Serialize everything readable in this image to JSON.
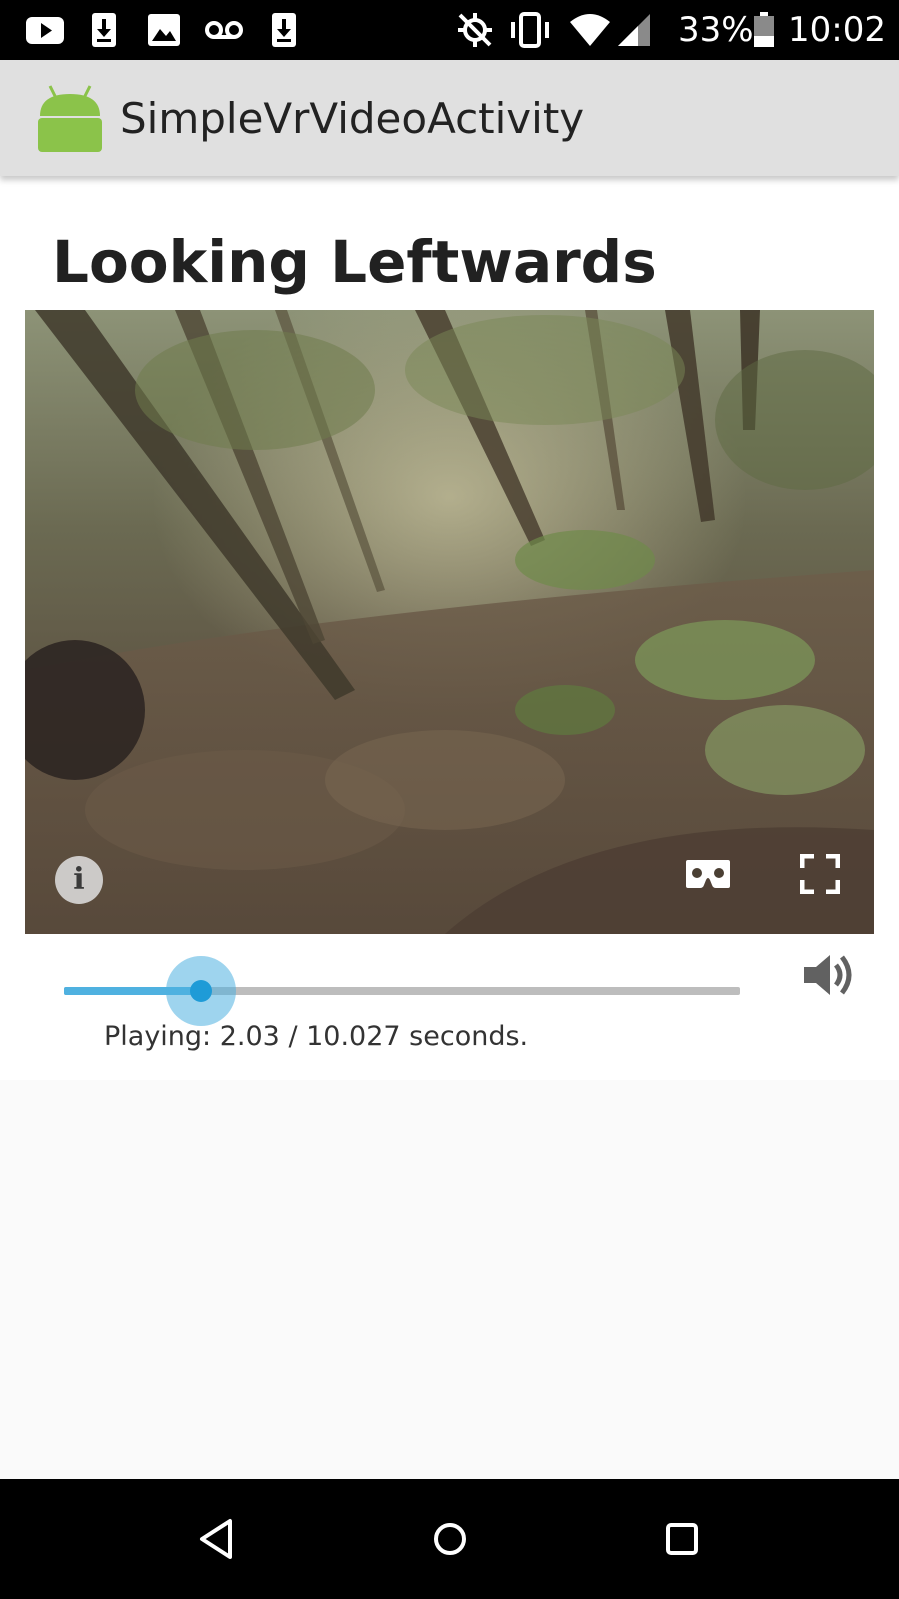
{
  "status_bar": {
    "battery_percent": "33%",
    "time": "10:02",
    "left_icons": [
      "youtube-icon",
      "download-icon",
      "image-icon",
      "voicemail-icon",
      "download-icon"
    ],
    "right_icons": [
      "location-off-icon",
      "vibrate-icon",
      "wifi-icon",
      "signal-icon",
      "battery-icon"
    ]
  },
  "app_bar": {
    "title": "SimpleVrVideoActivity",
    "logo_icon": "android-icon"
  },
  "video": {
    "title": "Looking Leftwards",
    "info_label": "i",
    "controls": [
      "info-icon",
      "cardboard-icon",
      "fullscreen-icon"
    ]
  },
  "playback": {
    "current_seconds": 2.03,
    "total_seconds": 10.027,
    "status_text": "Playing: 2.03 / 10.027 seconds.",
    "volume_icon": "volume-icon"
  },
  "nav_bar": {
    "buttons": [
      "back-icon",
      "home-icon",
      "recents-icon"
    ]
  },
  "colors": {
    "accent": "#4fb1e0",
    "thumb": "#1e9bd7",
    "app_bar": "#e0e0e0",
    "android_green": "#8bc34a"
  }
}
